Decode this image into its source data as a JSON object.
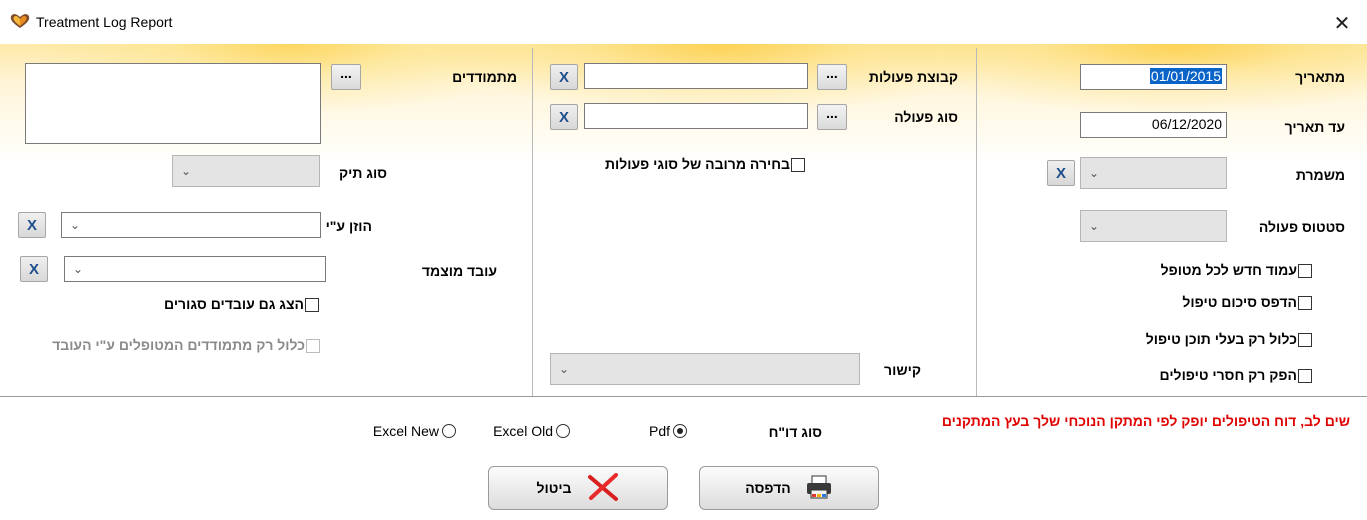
{
  "window": {
    "title": "Treatment Log Report",
    "close_glyph": "✕",
    "icon": "heart-leaf-icon"
  },
  "right_column": {
    "from_date_label": "מתאריך",
    "from_date_value": "01/01/2015",
    "to_date_label": "עד תאריך",
    "to_date_value": "06/12/2020",
    "shift_label": "משמרת",
    "action_status_label": "סטטוס פעולה",
    "checkboxes": [
      {
        "label": "עמוד חדש לכל מטופל",
        "checked": false
      },
      {
        "label": "הדפס סיכום טיפול",
        "checked": false
      },
      {
        "label": "כלול רק בעלי תוכן טיפול",
        "checked": false
      },
      {
        "label": "הפק רק חסרי טיפולים",
        "checked": false
      }
    ]
  },
  "middle_column": {
    "action_group_label": "קבוצת פעולות",
    "action_type_label": "סוג פעולה",
    "multi_select_label": "בחירה מרובה של סוגי פעולות",
    "link_label": "קישור"
  },
  "left_column": {
    "participants_label": "מתמודדים",
    "file_type_label": "סוג תיק",
    "entered_by_label": "הוזן ע\"י",
    "assigned_worker_label": "עובד מוצמד",
    "show_closed_label": "הצג גם עובדים סגורים",
    "only_treated_label": "כלול רק מתמודדים המטופלים ע\"י העובד"
  },
  "buttons": {
    "ellipsis": "...",
    "clear": "X",
    "print": "הדפסה",
    "cancel": "ביטול"
  },
  "report_type": {
    "label": "סוג דו\"ח",
    "options": [
      {
        "label": "Pdf",
        "selected": true
      },
      {
        "label": "Excel Old",
        "selected": false
      },
      {
        "label": "Excel New",
        "selected": false
      }
    ]
  },
  "notice": "שים לב, דוח הטיפולים יופק לפי המתקן הנוכחי שלך בעץ המתקנים",
  "colors": {
    "header_gradient": "#fdce46",
    "notice": "#e00000",
    "clear_button_text": "#1f4e8c",
    "selected_date_bg": "#0a64c8"
  }
}
